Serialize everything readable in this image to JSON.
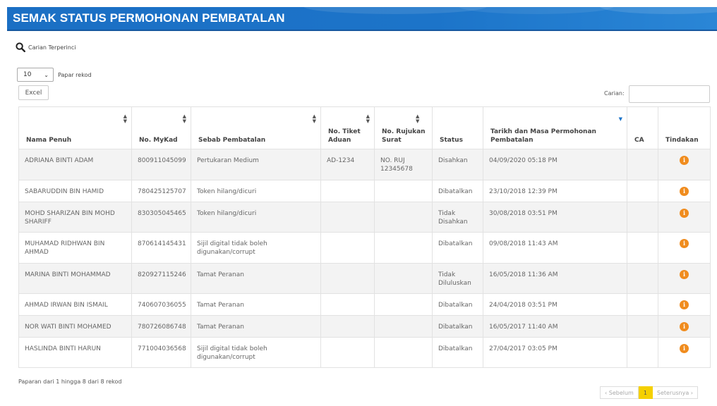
{
  "header": {
    "title": "SEMAK STATUS PERMOHONAN PEMBATALAN"
  },
  "search_link": {
    "label": "Carian Terperinci"
  },
  "length": {
    "value": "10",
    "label": "Papar rekod"
  },
  "excel_label": "Excel",
  "search": {
    "label": "Carian:",
    "value": ""
  },
  "columns": [
    "Nama Penuh",
    "No. MyKad",
    "Sebab Pembatalan",
    "No. Tiket Aduan",
    "No. Rujukan Surat",
    "Status",
    "Tarikh dan Masa Permohonan Pembatalan",
    "CA",
    "Tindakan"
  ],
  "rows": [
    {
      "nama": "ADRIANA BINTI ADAM",
      "mykad": "800911045099",
      "sebab": "Pertukaran Medium",
      "tiket": "AD-1234",
      "rujukan": "NO. RUJ 12345678",
      "status": "Disahkan",
      "tarikh": "04/09/2020 05:18 PM",
      "ca": ""
    },
    {
      "nama": "SABARUDDIN BIN HAMID",
      "mykad": "780425125707",
      "sebab": "Token hilang/dicuri",
      "tiket": "",
      "rujukan": "",
      "status": "Dibatalkan",
      "tarikh": "23/10/2018 12:39 PM",
      "ca": ""
    },
    {
      "nama": "MOHD SHARIZAN BIN MOHD SHARIFF",
      "mykad": "830305045465",
      "sebab": "Token hilang/dicuri",
      "tiket": "",
      "rujukan": "",
      "status": "Tidak Disahkan",
      "tarikh": "30/08/2018 03:51 PM",
      "ca": ""
    },
    {
      "nama": "MUHAMAD RIDHWAN BIN AHMAD",
      "mykad": "870614145431",
      "sebab": "Sijil digital tidak boleh digunakan/corrupt",
      "tiket": "",
      "rujukan": "",
      "status": "Dibatalkan",
      "tarikh": "09/08/2018 11:43 AM",
      "ca": ""
    },
    {
      "nama": "MARINA BINTI MOHAMMAD",
      "mykad": "820927115246",
      "sebab": "Tamat Peranan",
      "tiket": "",
      "rujukan": "",
      "status": "Tidak Diluluskan",
      "tarikh": "16/05/2018 11:36 AM",
      "ca": ""
    },
    {
      "nama": "AHMAD IRWAN BIN ISMAIL",
      "mykad": "740607036055",
      "sebab": "Tamat Peranan",
      "tiket": "",
      "rujukan": "",
      "status": "Dibatalkan",
      "tarikh": "24/04/2018 03:51 PM",
      "ca": ""
    },
    {
      "nama": "NOR WATI BINTI MOHAMED",
      "mykad": "780726086748",
      "sebab": "Tamat Peranan",
      "tiket": "",
      "rujukan": "",
      "status": "Dibatalkan",
      "tarikh": "16/05/2017 11:40 AM",
      "ca": ""
    },
    {
      "nama": "HASLINDA BINTI HARUN",
      "mykad": "771004036568",
      "sebab": "Sijil digital tidak boleh digunakan/corrupt",
      "tiket": "",
      "rujukan": "",
      "status": "Dibatalkan",
      "tarikh": "27/04/2017 03:05 PM",
      "ca": ""
    }
  ],
  "action_icon": "info-icon",
  "info_text": "Paparan dari 1 hingga 8 dari 8 rekod",
  "pager": {
    "prev": "‹ Sebelum",
    "current": "1",
    "next": "Seterusnya ›"
  },
  "colors": {
    "header": "#1c74c9",
    "action": "#f08c1e",
    "pager_active": "#f5d000"
  }
}
